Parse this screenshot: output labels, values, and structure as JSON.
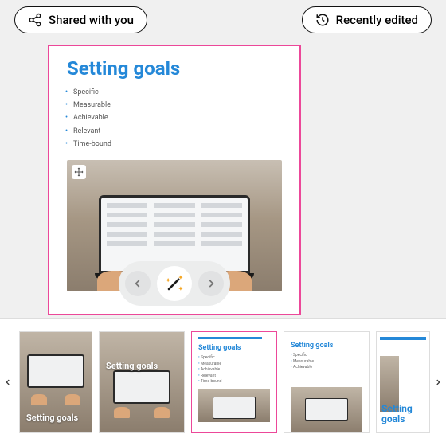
{
  "filters": {
    "shared": "Shared with you",
    "recent": "Recently edited"
  },
  "slide": {
    "title": "Setting goals",
    "bullets": [
      "Specific",
      "Measurable",
      "Achievable",
      "Relevant",
      "Time-bound"
    ]
  },
  "thumbs": {
    "t0_title": "Setting goals",
    "t1_title": "Setting goals",
    "t2_title": "Setting goals",
    "t3_title": "Setting goals",
    "t4_title": "Setting goals"
  }
}
